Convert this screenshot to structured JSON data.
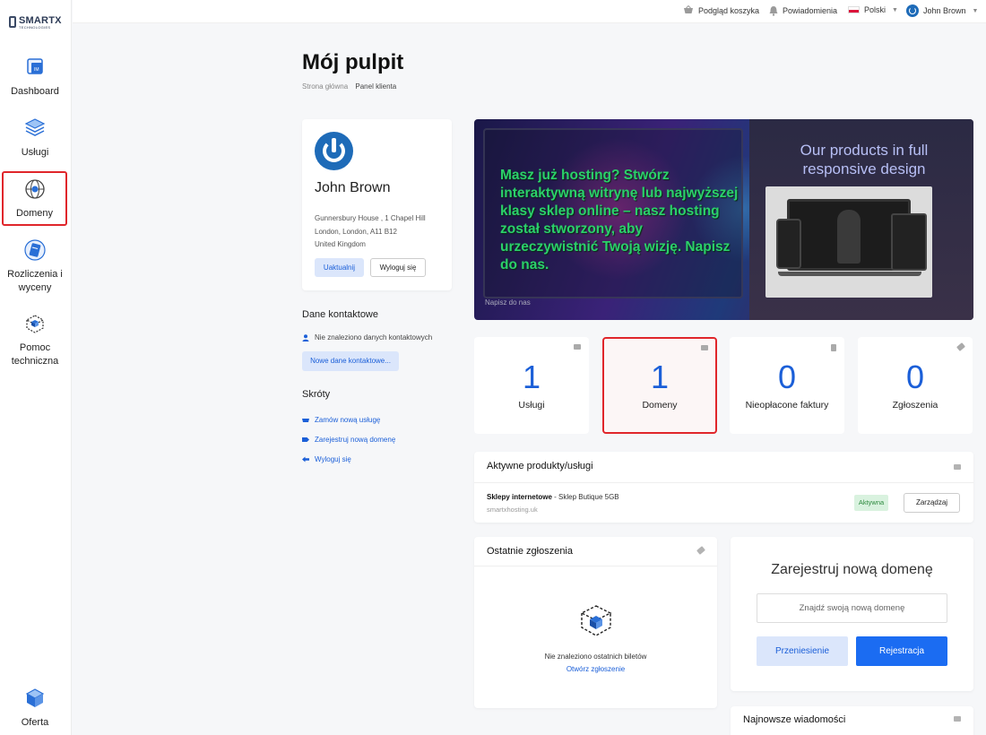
{
  "brand": {
    "name": "SMARTX",
    "tagline": "TECHNOLOGIES"
  },
  "sidebar": {
    "items": [
      {
        "label": "Dashboard",
        "icon": "dashboard-icon"
      },
      {
        "label": "Usługi",
        "icon": "services-stack-icon"
      },
      {
        "label": "Domeny",
        "icon": "globe-icon",
        "active": true
      },
      {
        "label": "Rozliczenia i wyceny",
        "icon": "billing-card-icon"
      },
      {
        "label": "Pomoc techniczna",
        "icon": "support-box-icon"
      }
    ],
    "bottom": {
      "label": "Oferta",
      "icon": "offer-box-icon"
    }
  },
  "topbar": {
    "cart": "Podgląd koszyka",
    "notifications": "Powiadomienia",
    "language": "Polski",
    "user": "John Brown"
  },
  "page": {
    "title": "Mój pulpit",
    "breadcrumb": [
      "Strona główna",
      "Panel klienta"
    ]
  },
  "profile": {
    "name": "John Brown",
    "address_line1": "Gunnersbury House , 1 Chapel Hill",
    "address_line2": "London, London, A11 B12",
    "address_line3": "United Kingdom",
    "update_button": "Uaktualnij",
    "logout_button": "Wyloguj się"
  },
  "contacts": {
    "title": "Dane kontaktowe",
    "empty": "Nie znaleziono danych kontaktowych",
    "new_button": "Nowe dane kontaktowe..."
  },
  "shortcuts": {
    "title": "Skróty",
    "items": [
      "Zamów nową usługę",
      "Zarejestruj nową domenę",
      "Wyloguj się"
    ]
  },
  "banner": {
    "text": "Masz już hosting? Stwórz interaktywną witrynę lub najwyższej klasy sklep online – nasz hosting został stworzony, aby urzeczywistnić Twoją wizję. Napisz do nas.",
    "small": "Napisz do nas",
    "heading": "Our products in full responsive design"
  },
  "stats": [
    {
      "value": "1",
      "label": "Usługi"
    },
    {
      "value": "1",
      "label": "Domeny"
    },
    {
      "value": "0",
      "label": "Nieopłacone faktury"
    },
    {
      "value": "0",
      "label": "Zgłoszenia"
    }
  ],
  "products": {
    "title": "Aktywne produkty/usługi",
    "item_name": "Sklepy internetowe",
    "item_plan": " - Sklep Butique 5GB",
    "item_domain": "smartxhosting.uk",
    "status": "Aktywna",
    "manage_button": "Zarządzaj"
  },
  "tickets": {
    "title": "Ostatnie zgłoszenia",
    "empty": "Nie znaleziono ostatnich biletów",
    "open_link": "Otwórz zgłoszenie"
  },
  "register_domain": {
    "title": "Zarejestruj nową domenę",
    "placeholder": "Znajdź swoją nową domenę",
    "transfer_button": "Przeniesienie",
    "register_button": "Rejestracja"
  },
  "news": {
    "title": "Najnowsze wiadomości"
  },
  "colors": {
    "accent": "#1b6cf2",
    "highlight_border": "#e0262b",
    "banner_text": "#2bd06a"
  }
}
